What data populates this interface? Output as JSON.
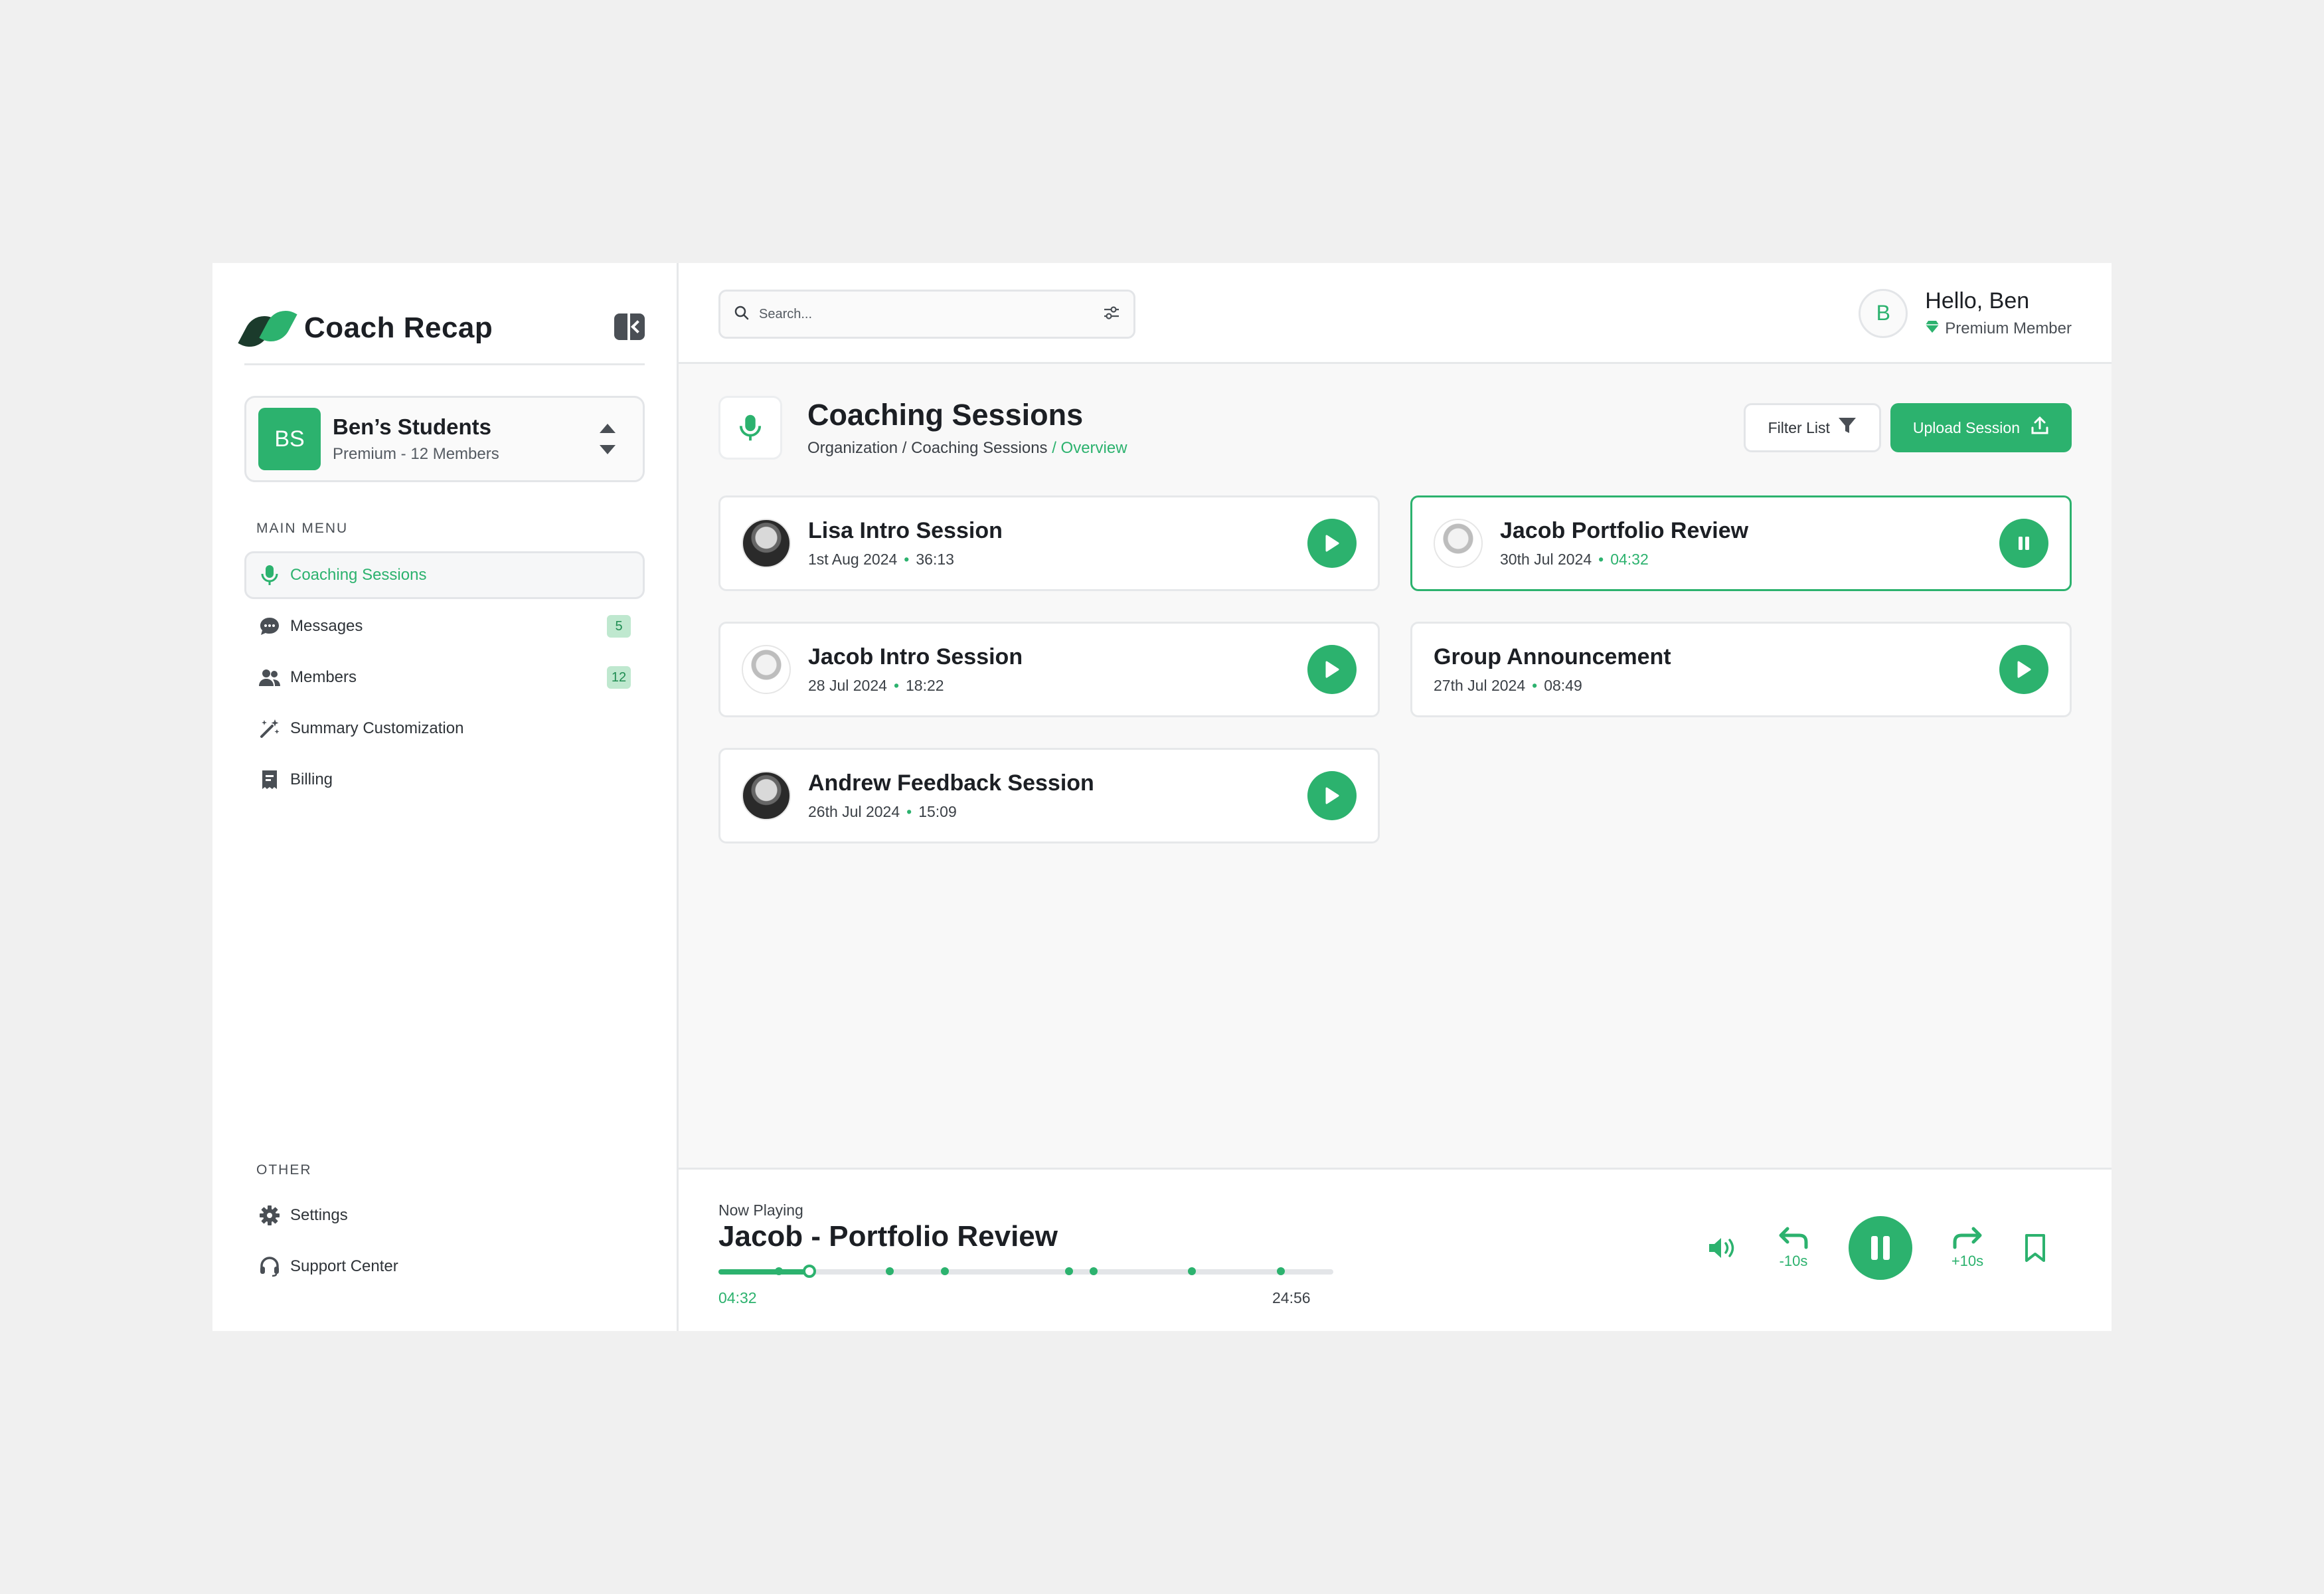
{
  "app": {
    "name": "Coach Recap"
  },
  "team": {
    "initials": "BS",
    "name": "Ben’s Students",
    "subtitle": "Premium - 12 Members"
  },
  "main_menu": {
    "label": "MAIN MENU",
    "items": [
      {
        "label": "Coaching Sessions",
        "icon": "microphone-icon",
        "active": true
      },
      {
        "label": "Messages",
        "icon": "chat-bubble-icon",
        "badge": "5"
      },
      {
        "label": "Members",
        "icon": "users-icon",
        "badge": "12"
      },
      {
        "label": "Summary Customization",
        "icon": "magic-wand-icon"
      },
      {
        "label": "Billing",
        "icon": "receipt-icon"
      }
    ]
  },
  "other_menu": {
    "label": "OTHER",
    "items": [
      {
        "label": "Settings",
        "icon": "gear-icon"
      },
      {
        "label": "Support Center",
        "icon": "headset-icon"
      }
    ]
  },
  "search": {
    "placeholder": "Search..."
  },
  "user": {
    "initial": "B",
    "greeting": "Hello, Ben",
    "status": "Premium Member"
  },
  "page": {
    "title": "Coaching Sessions",
    "breadcrumb_base": "Organization / Coaching Sessions ",
    "breadcrumb_current": "/ Overview",
    "filter_label": "Filter List",
    "upload_label": "Upload Session"
  },
  "sessions": [
    {
      "title": "Lisa Intro Session",
      "date": "1st Aug 2024",
      "duration": "36:13",
      "playing": false
    },
    {
      "title": "Jacob Portfolio Review",
      "date": "30th Jul 2024",
      "duration": "04:32",
      "playing": true
    },
    {
      "title": "Jacob Intro Session",
      "date": "28 Jul 2024",
      "duration": "18:22",
      "playing": false
    },
    {
      "title": "Group Announcement",
      "date": "27th Jul 2024",
      "duration": "08:49",
      "playing": false
    },
    {
      "title": "Andrew Feedback Session",
      "date": "26th Jul 2024",
      "duration": "15:09",
      "playing": false
    }
  ],
  "player": {
    "label": "Now Playing",
    "title": "Jacob - Portfolio Review",
    "current_time": "04:32",
    "total_time": "24:56",
    "progress": 0.148,
    "markers": [
      0.098,
      0.279,
      0.368,
      0.57,
      0.61,
      0.77,
      0.915
    ],
    "rewind_label": "-10s",
    "forward_label": "+10s"
  },
  "colors": {
    "accent": "#2cb26e",
    "dark": "#1c1f24",
    "border": "#e6e8ea"
  }
}
